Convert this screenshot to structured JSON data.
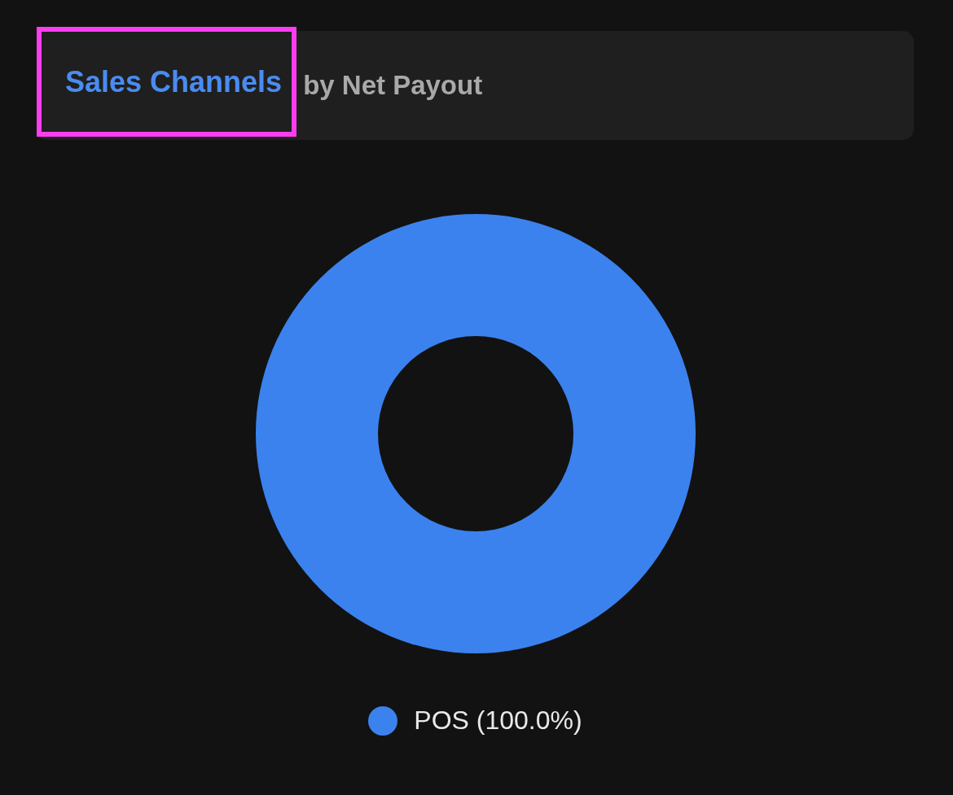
{
  "header": {
    "title": "Sales Channels",
    "subtitle": "by Net Payout",
    "title_highlighted": true
  },
  "chart": {
    "legend": [
      {
        "label": "POS (100.0%)",
        "color": "#3b82ee"
      }
    ]
  }
}
